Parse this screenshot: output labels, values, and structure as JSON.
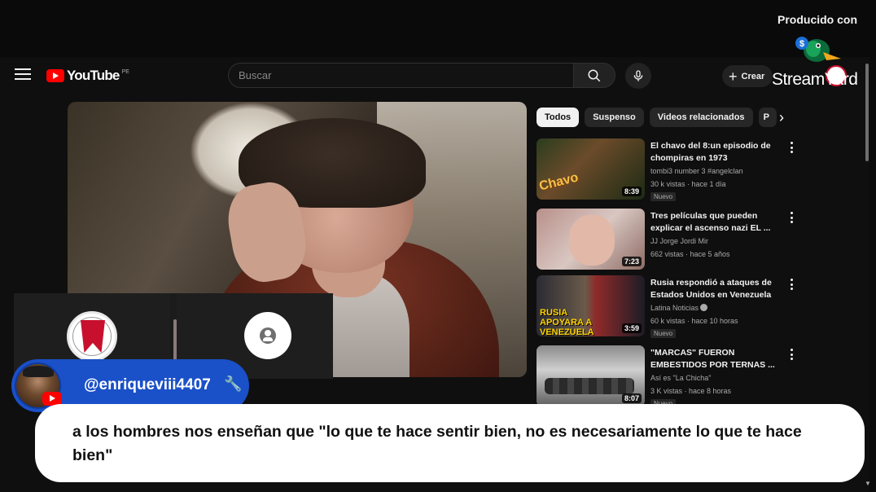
{
  "watermark": {
    "produced_label": "Producido con",
    "brand": "StreamYard"
  },
  "header": {
    "logo_text": "YouTube",
    "country": "PE",
    "search_placeholder": "Buscar",
    "create_label": "Crear"
  },
  "chips": [
    "Todos",
    "Suspenso",
    "Videos relacionados",
    "P"
  ],
  "related": [
    {
      "title": "El chavo del 8:un episodio de chompiras en 1973",
      "channel": "tombi3 number 3 #angelclan",
      "meta": "30 k vistas · hace 1 día",
      "duration": "8:39",
      "badge": "Nuevo",
      "thumb_text": "Chavo"
    },
    {
      "title": "Tres películas que pueden explicar el ascenso nazi EL ...",
      "channel": "JJ Jorge Jordi Mir",
      "meta": "662 vistas · hace 5 años",
      "duration": "7:23",
      "badge": "",
      "thumb_text": ""
    },
    {
      "title": "Rusia respondió a ataques de Estados Unidos en Venezuela",
      "channel": "Latina Noticias",
      "meta": "60 k vistas · hace 10 horas",
      "duration": "3:59",
      "badge": "Nuevo",
      "thumb_text": "RUSIA APOYARA A VENEZUELA"
    },
    {
      "title": "\"MARCAS\" FUERON EMBESTIDOS POR TERNAS ...",
      "channel": "Así es \"La Chicha\"",
      "meta": "3 K vistas · hace 8 horas",
      "duration": "8:07",
      "badge": "Nuevo",
      "thumb_text": ""
    }
  ],
  "overlay": {
    "username": "@enriqueviii4407",
    "comment": "a los hombres nos enseñan que \"lo que te hace sentir bien, no es necesariamente lo que te hace bien\""
  }
}
